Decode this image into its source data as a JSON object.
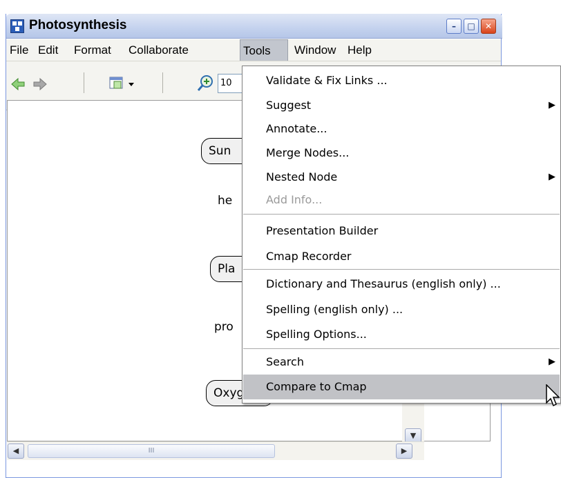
{
  "window": {
    "title": "Photosynthesis",
    "controls": {
      "minimize": "–",
      "maximize": "□",
      "close": "✕"
    }
  },
  "menubar": {
    "items": [
      "File",
      "Edit",
      "Format",
      "Collaborate",
      "Tools",
      "Window",
      "Help"
    ],
    "active": "Tools"
  },
  "toolbar": {
    "zoom_value": "10"
  },
  "canvas": {
    "nodes": [
      "Sun",
      "Pla",
      "Oxygen"
    ],
    "link_texts": [
      "he",
      "pro"
    ]
  },
  "tools_menu": {
    "items": [
      {
        "label": "Validate & Fix Links ...",
        "submenu": false,
        "disabled": false,
        "highlighted": false
      },
      {
        "label": "Suggest",
        "submenu": true,
        "disabled": false,
        "highlighted": false
      },
      {
        "label": "Annotate...",
        "submenu": false,
        "disabled": false,
        "highlighted": false
      },
      {
        "label": "Merge Nodes...",
        "submenu": false,
        "disabled": false,
        "highlighted": false
      },
      {
        "label": "Nested Node",
        "submenu": true,
        "disabled": false,
        "highlighted": false
      },
      {
        "label": "Add Info...",
        "submenu": false,
        "disabled": true,
        "highlighted": false
      },
      {
        "label": "Presentation Builder",
        "submenu": false,
        "disabled": false,
        "highlighted": false
      },
      {
        "label": "Cmap Recorder",
        "submenu": false,
        "disabled": false,
        "highlighted": false
      },
      {
        "label": "Dictionary and Thesaurus (english only) ...",
        "submenu": false,
        "disabled": false,
        "highlighted": false
      },
      {
        "label": "Spelling (english only) ...",
        "submenu": false,
        "disabled": false,
        "highlighted": false
      },
      {
        "label": "Spelling Options...",
        "submenu": false,
        "disabled": false,
        "highlighted": false
      },
      {
        "label": "Search",
        "submenu": true,
        "disabled": false,
        "highlighted": false
      },
      {
        "label": "Compare to Cmap",
        "submenu": false,
        "disabled": false,
        "highlighted": true
      }
    ],
    "submenu_arrow": "▶"
  },
  "scrollbars": {
    "up": "▲",
    "down": "▼",
    "left": "◀",
    "right": "▶",
    "grip": "III"
  },
  "colors": {
    "menu_highlight": "#c1c2c6",
    "title_gradient_top": "#dfe6f5",
    "close_button": "#d9431a"
  }
}
